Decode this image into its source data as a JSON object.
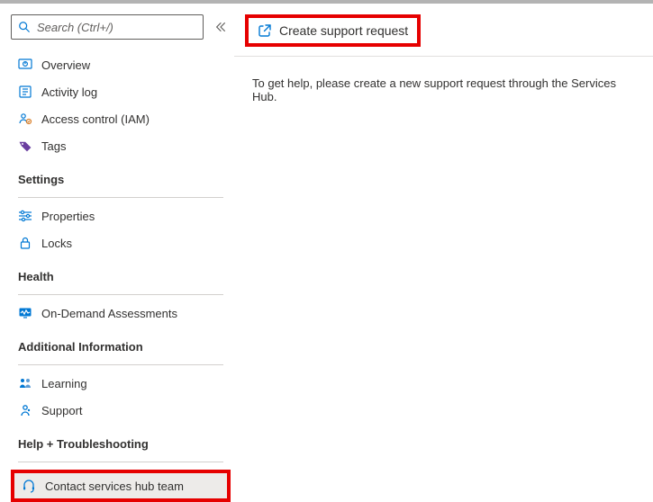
{
  "search": {
    "placeholder": "Search (Ctrl+/)"
  },
  "nav": {
    "overview": "Overview",
    "activity_log": "Activity log",
    "access_control": "Access control (IAM)",
    "tags": "Tags"
  },
  "sections": {
    "settings": {
      "title": "Settings",
      "properties": "Properties",
      "locks": "Locks"
    },
    "health": {
      "title": "Health",
      "on_demand": "On-Demand Assessments"
    },
    "additional": {
      "title": "Additional Information",
      "learning": "Learning",
      "support": "Support"
    },
    "help": {
      "title": "Help + Troubleshooting",
      "contact": "Contact services hub team"
    }
  },
  "toolbar": {
    "create_support": "Create support request"
  },
  "main": {
    "body": "To get help, please create a new support request through the Services Hub."
  }
}
